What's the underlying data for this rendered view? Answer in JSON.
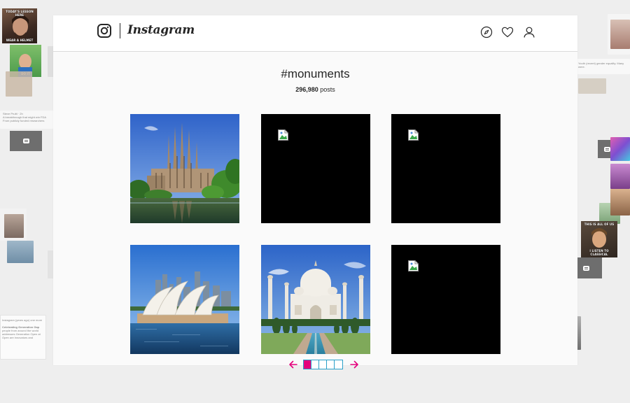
{
  "app": {
    "wordmark": "Instagram",
    "icons": {
      "logo": "instagram-glyph-icon",
      "explore": "compass-icon",
      "activity": "heart-icon",
      "profile": "person-icon"
    }
  },
  "hashtag": {
    "title": "#monuments",
    "count": "296,980",
    "count_suffix": " posts"
  },
  "grid": {
    "tiles": [
      {
        "name": "sagrada-familia-photo",
        "type": "image"
      },
      {
        "name": "broken-image",
        "type": "broken"
      },
      {
        "name": "broken-image",
        "type": "broken"
      },
      {
        "name": "sydney-opera-house-photo",
        "type": "image"
      },
      {
        "name": "taj-mahal-photo",
        "type": "image"
      },
      {
        "name": "broken-image",
        "type": "broken"
      }
    ]
  },
  "pager": {
    "pages": 5,
    "active": 1,
    "accent": "#e4007c",
    "border": "#2aa0c8"
  },
  "background": {
    "memes": [
      {
        "top": "TODAY'S LESSON HERE",
        "bottom": "WEAR A HELMET"
      },
      {
        "top": "",
        "bottom": "DO IT"
      },
      {
        "top": "THIS IS ALL OF US",
        "bottom": "I LISTEN TO CLASSICAL"
      }
    ],
    "snippets": [
      "Instagram (years ago) one more",
      "Celebrating Generation Gap",
      "Youth (recent) gender equality. Many were."
    ]
  }
}
